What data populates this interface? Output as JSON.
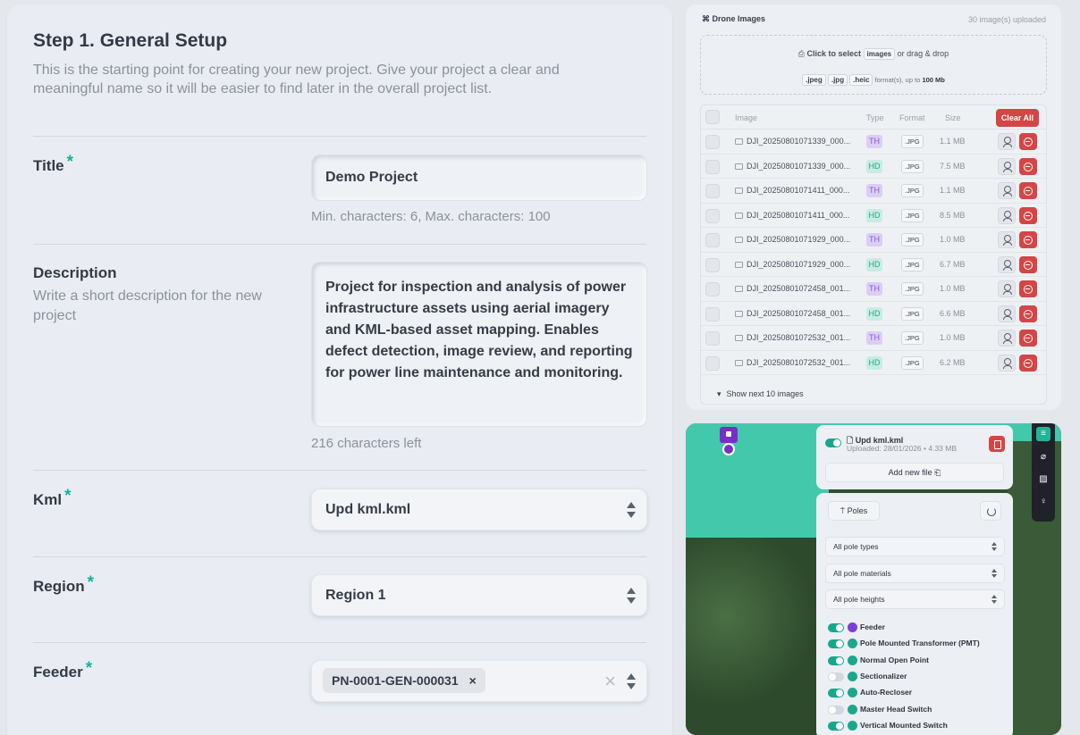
{
  "form": {
    "title": "Step 1. General Setup",
    "subtitle": "This is the starting point for creating your new project. Give your project a clear and meaningful name so it will be easier to find later in the overall project list.",
    "title_field": {
      "label": "Title",
      "required_mark": "*",
      "value": "Demo Project",
      "hint": "Min. characters: 6, Max. characters: 100"
    },
    "description_field": {
      "label": "Description",
      "sublabel": "Write a short description for the new project",
      "value": "Project for inspection and analysis of power infrastructure assets using aerial imagery and KML-based asset mapping. Enables defect detection, image review, and reporting for power line maintenance and monitoring.",
      "hint": "216 characters left"
    },
    "kml_field": {
      "label": "Kml",
      "required_mark": "*",
      "value": "Upd kml.kml"
    },
    "region_field": {
      "label": "Region",
      "required_mark": "*",
      "value": "Region 1"
    },
    "feeder_field": {
      "label": "Feeder",
      "required_mark": "*",
      "tag": "PN-0001-GEN-000031",
      "tag_remove": "×",
      "clear": "×"
    }
  },
  "drone": {
    "title": "⌘ Drone Images",
    "count": "30 image(s) uploaded",
    "dropzone": {
      "click_text": "Click to select",
      "chip": "images",
      "drag_text": "or drag & drop",
      "formats": [
        ".jpeg",
        ".jpg",
        ".heic"
      ],
      "format_suffix": "format(s), up to",
      "max_size": "100 Mb"
    },
    "headers": {
      "image": "Image",
      "type": "Type",
      "format": "Format",
      "size": "Size",
      "clear_all": "Clear All"
    },
    "rows": [
      {
        "name": "DJI_20250801071339_000...",
        "type": "TH",
        "format": ".JPG",
        "size": "1.1 MB"
      },
      {
        "name": "DJI_20250801071339_000...",
        "type": "HD",
        "format": ".JPG",
        "size": "7.5 MB"
      },
      {
        "name": "DJI_20250801071411_000...",
        "type": "TH",
        "format": ".JPG",
        "size": "1.1 MB"
      },
      {
        "name": "DJI_20250801071411_000...",
        "type": "HD",
        "format": ".JPG",
        "size": "8.5 MB"
      },
      {
        "name": "DJI_20250801071929_000...",
        "type": "TH",
        "format": ".JPG",
        "size": "1.0 MB"
      },
      {
        "name": "DJI_20250801071929_000...",
        "type": "HD",
        "format": ".JPG",
        "size": "6.7 MB"
      },
      {
        "name": "DJI_20250801072458_001...",
        "type": "TH",
        "format": ".JPG",
        "size": "1.0 MB"
      },
      {
        "name": "DJI_20250801072458_001...",
        "type": "HD",
        "format": ".JPG",
        "size": "6.6 MB"
      },
      {
        "name": "DJI_20250801072532_001...",
        "type": "TH",
        "format": ".JPG",
        "size": "1.0 MB"
      },
      {
        "name": "DJI_20250801072532_001...",
        "type": "HD",
        "format": ".JPG",
        "size": "6.2 MB"
      }
    ],
    "show_next": "Show next 10 images"
  },
  "map": {
    "kml": {
      "name": "🗋 Upd kml.kml",
      "meta": "Uploaded: 28/01/2026 • 4.33 MB",
      "add_file": "Add new file"
    },
    "poles_button": "⍑ Poles",
    "selects": [
      "All pole types",
      "All pole materials",
      "All pole heights"
    ],
    "layers": [
      {
        "name": "Feeder",
        "on": true,
        "color": "#7a3fd6"
      },
      {
        "name": "Pole Mounted Transformer (PMT)",
        "on": true,
        "color": "#1aa88d"
      },
      {
        "name": "Normal Open Point",
        "on": true,
        "color": "#1aa88d"
      },
      {
        "name": "Sectionalizer",
        "on": false,
        "color": "#1aa88d"
      },
      {
        "name": "Auto-Recloser",
        "on": true,
        "color": "#1aa88d"
      },
      {
        "name": "Master Head Switch",
        "on": false,
        "color": "#1aa88d"
      },
      {
        "name": "Vertical Mounted Switch",
        "on": true,
        "color": "#1aa88d"
      }
    ],
    "tools": [
      "sliders-icon",
      "ruler-icon",
      "hatch-icon",
      "bulb-icon"
    ]
  },
  "colors": {
    "accent": "#13b39a",
    "danger": "#d64545",
    "th_badge": "#dccdf5",
    "hd_badge": "#c8ece3"
  }
}
